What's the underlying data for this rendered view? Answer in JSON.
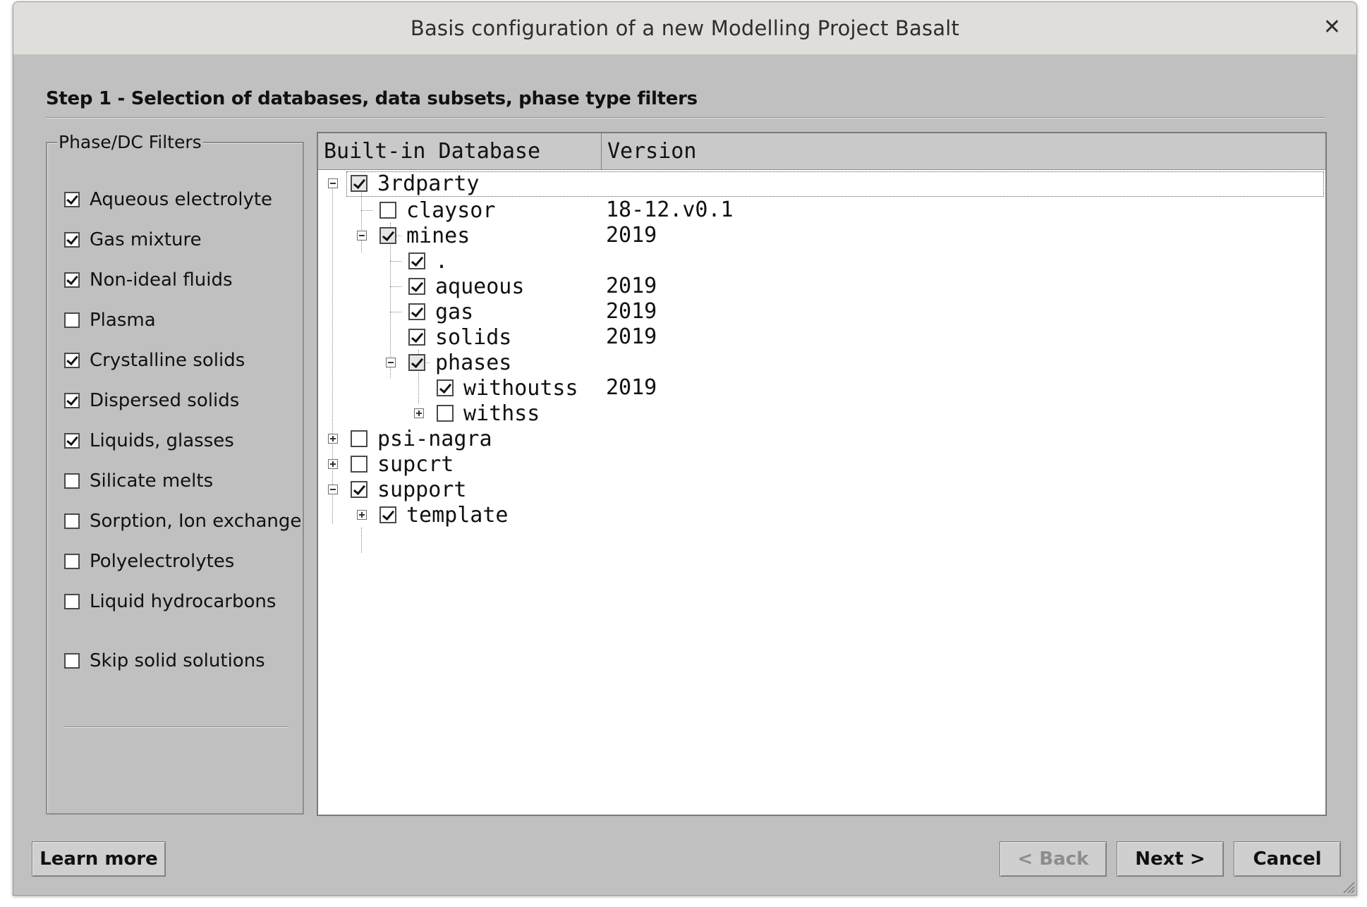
{
  "window": {
    "title": "Basis configuration of a new Modelling Project  Basalt",
    "close_icon": "close-icon"
  },
  "step_title": "Step 1 - Selection of databases, data subsets, phase type filters",
  "filters": {
    "legend": "Phase/DC Filters",
    "items": [
      {
        "label": "Aqueous electrolyte",
        "checked": true
      },
      {
        "label": "Gas mixture",
        "checked": true
      },
      {
        "label": "Non-ideal fluids",
        "checked": true
      },
      {
        "label": "Plasma",
        "checked": false
      },
      {
        "label": "Crystalline solids",
        "checked": true
      },
      {
        "label": "Dispersed solids",
        "checked": true
      },
      {
        "label": "Liquids, glasses",
        "checked": true
      },
      {
        "label": "Silicate melts",
        "checked": false
      },
      {
        "label": "Sorption, Ion exchange",
        "checked": false
      },
      {
        "label": "Polyelectrolytes",
        "checked": false
      },
      {
        "label": "Liquid hydrocarbons",
        "checked": false
      }
    ],
    "skip": {
      "label": "Skip solid solutions",
      "checked": false
    }
  },
  "tree": {
    "columns": [
      "Built-in Database",
      "Version"
    ],
    "rows": [
      {
        "label": "3rdparty",
        "version": "",
        "state": "partial",
        "expander": "minus"
      },
      {
        "label": "claysor",
        "version": "18-12.v0.1",
        "state": "unchecked",
        "expander": ""
      },
      {
        "label": "mines",
        "version": "2019",
        "state": "partial",
        "expander": "minus"
      },
      {
        "label": ".",
        "version": "",
        "state": "checked",
        "expander": ""
      },
      {
        "label": "aqueous",
        "version": "2019",
        "state": "checked",
        "expander": ""
      },
      {
        "label": "gas",
        "version": "2019",
        "state": "checked",
        "expander": ""
      },
      {
        "label": "solids",
        "version": "2019",
        "state": "checked",
        "expander": ""
      },
      {
        "label": "phases",
        "version": "",
        "state": "partial",
        "expander": "minus"
      },
      {
        "label": "withoutss",
        "version": "2019",
        "state": "checked",
        "expander": ""
      },
      {
        "label": "withss",
        "version": "",
        "state": "unchecked",
        "expander": "plus"
      },
      {
        "label": "psi-nagra",
        "version": "",
        "state": "unchecked",
        "expander": "plus"
      },
      {
        "label": "supcrt",
        "version": "",
        "state": "unchecked",
        "expander": "plus"
      },
      {
        "label": "support",
        "version": "",
        "state": "checked",
        "expander": "minus"
      },
      {
        "label": "template",
        "version": "",
        "state": "checked",
        "expander": "plus"
      }
    ]
  },
  "buttons": {
    "learn_more": "Learn more",
    "back": "< Back",
    "next": "Next >",
    "cancel": "Cancel"
  }
}
